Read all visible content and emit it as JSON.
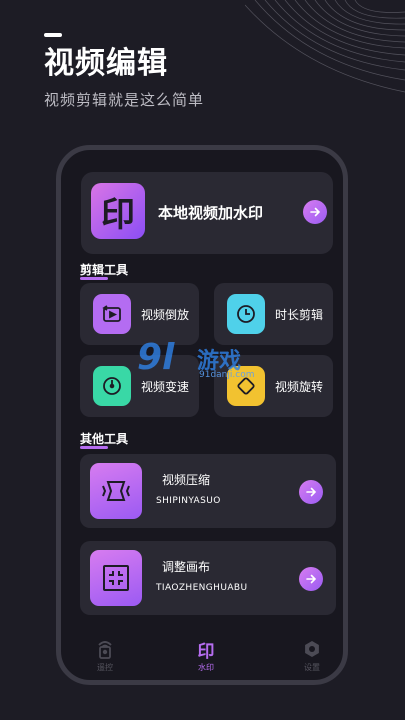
{
  "header": {
    "title": "视频编辑",
    "subtitle": "视频剪辑就是这么简单"
  },
  "hero_card": {
    "icon_glyph": "印",
    "label": "本地视频加水印"
  },
  "sections": {
    "edit_tools": "剪辑工具",
    "other_tools": "其他工具"
  },
  "tools": [
    {
      "label": "视频倒放",
      "color": "#b46cf2"
    },
    {
      "label": "时长剪辑",
      "color": "#4fd1ea"
    },
    {
      "label": "视频变速",
      "color": "#39d8a6"
    },
    {
      "label": "视频旋转",
      "color": "#f2c230"
    }
  ],
  "other_tools": [
    {
      "name": "视频压缩",
      "pinyin": "SHIPINYASUO"
    },
    {
      "name": "调整画布",
      "pinyin": "TIAOZHENGHUABU"
    }
  ],
  "watermark": {
    "mark": "9l",
    "text": "游戏",
    "url": "91danji.com"
  },
  "tabbar": [
    {
      "label": "遥控",
      "active": false
    },
    {
      "label": "水印",
      "glyph": "印",
      "active": true
    },
    {
      "label": "设置",
      "active": false
    }
  ],
  "colors": {
    "accent": "#b66df0",
    "background": "#1d1c25",
    "card": "#2a2933"
  }
}
